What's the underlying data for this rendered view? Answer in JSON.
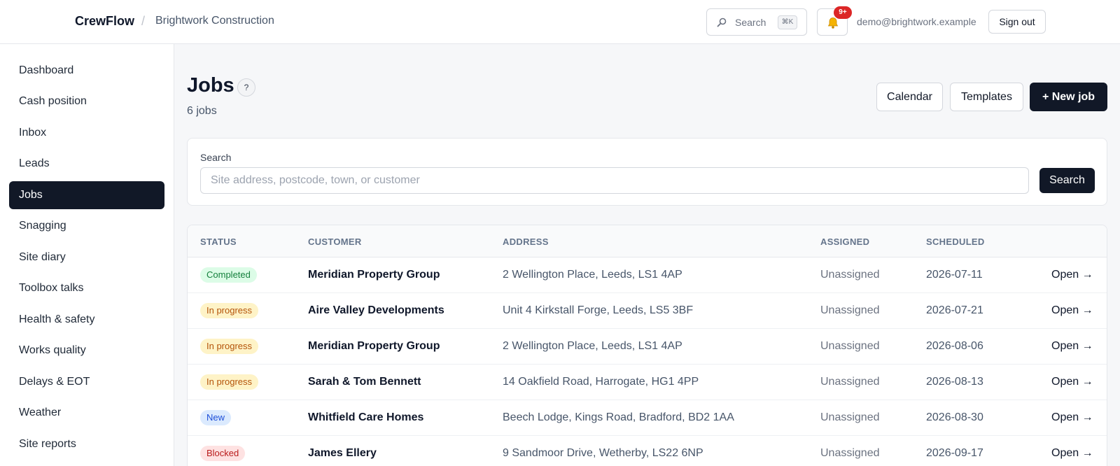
{
  "topbar": {
    "brand": "CrewFlow",
    "separator": "/",
    "organization": "Brightwork Construction",
    "search_label": "Search",
    "search_shortcut": "⌘K",
    "notifications_badge": "9+",
    "user_email": "demo@brightwork.example",
    "sign_out_label": "Sign out",
    "search_icon": "search-icon",
    "bell_icon": "bell-icon"
  },
  "sidebar": {
    "items": [
      {
        "label": "Dashboard",
        "active": false
      },
      {
        "label": "Cash position",
        "active": false
      },
      {
        "label": "Inbox",
        "active": false
      },
      {
        "label": "Leads",
        "active": false
      },
      {
        "label": "Jobs",
        "active": true
      },
      {
        "label": "Snagging",
        "active": false
      },
      {
        "label": "Site diary",
        "active": false
      },
      {
        "label": "Toolbox talks",
        "active": false
      },
      {
        "label": "Health & safety",
        "active": false
      },
      {
        "label": "Works quality",
        "active": false
      },
      {
        "label": "Delays & EOT",
        "active": false
      },
      {
        "label": "Weather",
        "active": false
      },
      {
        "label": "Site reports",
        "active": false
      }
    ]
  },
  "page": {
    "title": "Jobs",
    "help_label": "?",
    "count_text": "6 jobs",
    "actions": {
      "calendar": "Calendar",
      "templates": "Templates",
      "new_job": "+ New job"
    }
  },
  "search": {
    "label": "Search",
    "placeholder": "Site address, postcode, town, or customer",
    "value": "",
    "button_label": "Search"
  },
  "table": {
    "headers": {
      "status": "STATUS",
      "customer": "CUSTOMER",
      "address": "ADDRESS",
      "assigned": "ASSIGNED",
      "scheduled": "SCHEDULED"
    },
    "open_label": "Open →",
    "rows": [
      {
        "status": "Completed",
        "customer": "Meridian Property Group",
        "address": "2 Wellington Place, Leeds, LS1 4AP",
        "assigned": "Unassigned",
        "scheduled": "2026-07-11"
      },
      {
        "status": "In progress",
        "customer": "Aire Valley Developments",
        "address": "Unit 4 Kirkstall Forge, Leeds, LS5 3BF",
        "assigned": "Unassigned",
        "scheduled": "2026-07-21"
      },
      {
        "status": "In progress",
        "customer": "Meridian Property Group",
        "address": "2 Wellington Place, Leeds, LS1 4AP",
        "assigned": "Unassigned",
        "scheduled": "2026-08-06"
      },
      {
        "status": "In progress",
        "customer": "Sarah & Tom Bennett",
        "address": "14 Oakfield Road, Harrogate, HG1 4PP",
        "assigned": "Unassigned",
        "scheduled": "2026-08-13"
      },
      {
        "status": "New",
        "customer": "Whitfield Care Homes",
        "address": "Beech Lodge, Kings Road, Bradford, BD2 1AA",
        "assigned": "Unassigned",
        "scheduled": "2026-08-30"
      },
      {
        "status": "Blocked",
        "customer": "James Ellery",
        "address": "9 Sandmoor Drive, Wetherby, LS22 6NP",
        "assigned": "Unassigned",
        "scheduled": "2026-09-17"
      }
    ]
  },
  "status_colors": {
    "Completed": {
      "bg": "#dcfce7",
      "fg": "#15803d"
    },
    "In progress": {
      "bg": "#fef3c7",
      "fg": "#b45309"
    },
    "New": {
      "bg": "#dbeafe",
      "fg": "#1d4ed8"
    },
    "Blocked": {
      "bg": "#fee2e2",
      "fg": "#b91c1c"
    }
  },
  "colors": {
    "primary": "#111827",
    "badge": "#dc2626"
  }
}
